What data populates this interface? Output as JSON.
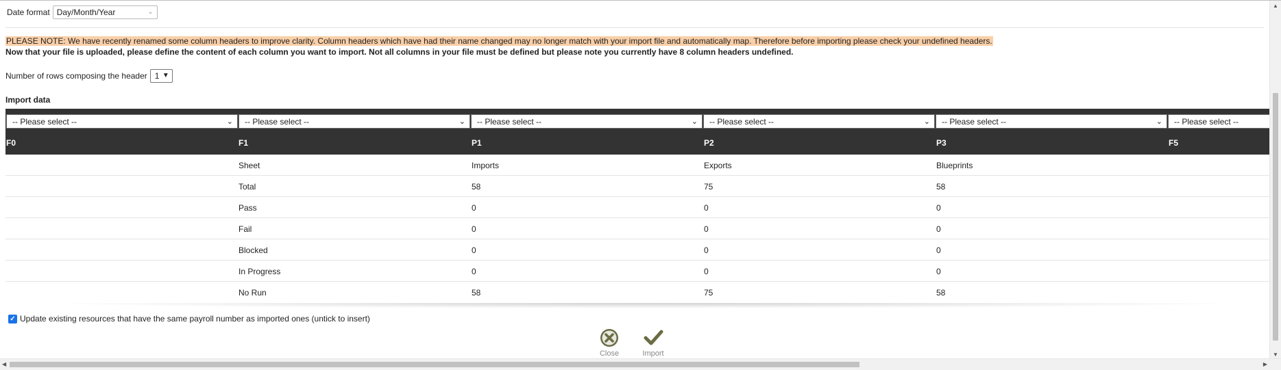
{
  "date_format": {
    "label": "Date format",
    "value": "Day/Month/Year"
  },
  "notice": {
    "highlight": "PLEASE NOTE: We have recently renamed some column headers to improve clarity. Column headers which have had their name changed may no longer match with your import file and automatically map. Therefore before importing please check your undefined headers.",
    "instruction": "Now that your file is uploaded, please define the content of each column you want to import. Not all columns in your file must be defined but please note you currently have 8 column headers undefined."
  },
  "header_rows": {
    "label": "Number of rows composing the header",
    "value": "1"
  },
  "import_data": {
    "title": "Import data",
    "select_placeholder": "-- Please select --",
    "columns": [
      "F0",
      "F1",
      "P1",
      "P2",
      "P3",
      "F5"
    ],
    "rows": [
      [
        "",
        "Sheet",
        "Imports",
        "Exports",
        "Blueprints",
        ""
      ],
      [
        "",
        "Total",
        "58",
        "75",
        "58",
        ""
      ],
      [
        "",
        "Pass",
        "0",
        "0",
        "0",
        ""
      ],
      [
        "",
        "Fail",
        "0",
        "0",
        "0",
        ""
      ],
      [
        "",
        "Blocked",
        "0",
        "0",
        "0",
        ""
      ],
      [
        "",
        "In Progress",
        "0",
        "0",
        "0",
        ""
      ],
      [
        "",
        "No Run",
        "58",
        "75",
        "58",
        ""
      ]
    ]
  },
  "update_option": {
    "label": "Update existing resources that have the same payroll number as imported ones (untick to insert)",
    "checked": true
  },
  "actions": {
    "close": "Close",
    "import": "Import"
  },
  "icons": {
    "close": "close-circle-icon",
    "import": "checkmark-icon"
  },
  "colors": {
    "highlight": "#f9cfa8",
    "table_header": "#333333",
    "checkbox": "#1a73e8"
  }
}
